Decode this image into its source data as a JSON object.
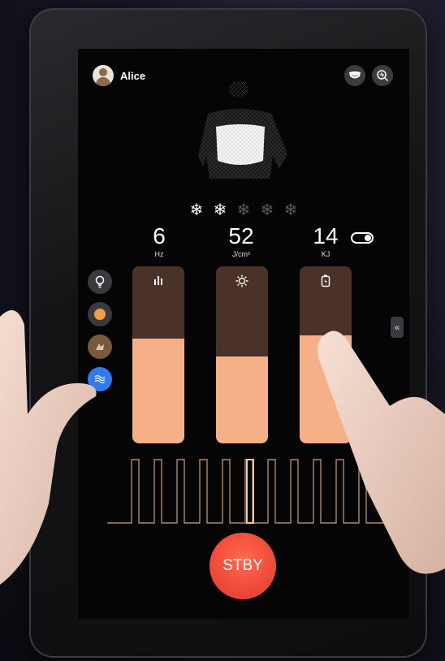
{
  "user": {
    "name": "Alice",
    "avatar_icon": "user-avatar-icon"
  },
  "top_icons": [
    "face-mask-icon",
    "scan-icon"
  ],
  "cooling_level": {
    "active": 2,
    "total": 5
  },
  "metrics": [
    {
      "value": "6",
      "unit": "Hz"
    },
    {
      "value": "52",
      "unit": "J/cm²"
    },
    {
      "value": "14",
      "unit": "KJ"
    }
  ],
  "energy_toggle": {
    "on": true
  },
  "side_buttons": [
    "bulb-icon",
    "orange-dot-icon",
    "treatment-area-icon",
    "wave-icon"
  ],
  "sliders": [
    {
      "icon": "bars-icon",
      "level": 0.59
    },
    {
      "icon": "sun-icon",
      "level": 0.49
    },
    {
      "icon": "battery-icon",
      "level": 0.61
    }
  ],
  "stby_button": {
    "label": "STBY",
    "color": "#f04a3a"
  },
  "accent_color": "#f5b088",
  "collapse_icon": "«"
}
